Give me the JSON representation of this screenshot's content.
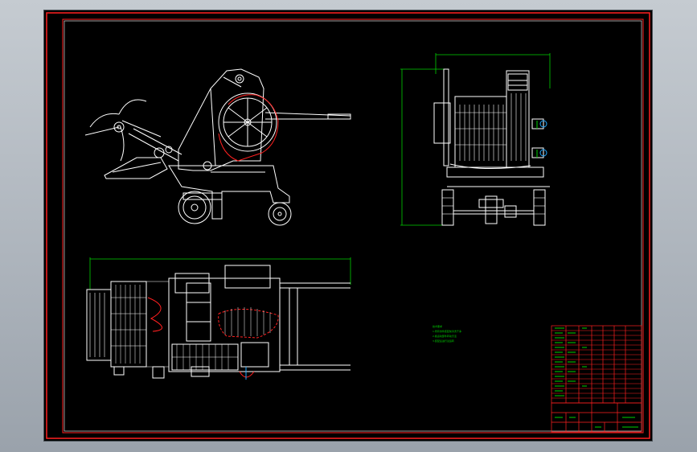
{
  "viewer": {
    "background_color": "#b3bac2",
    "sheet_color": "#000000",
    "frame_color": "#ff2020",
    "line_color": "#ffffff",
    "dimension_color": "#00d000",
    "highlight_color": "#ff2020",
    "accent_color": "#22a9ff"
  },
  "drawing": {
    "views": [
      "side-elevation",
      "end-elevation",
      "plan-view"
    ],
    "notes_block": {
      "heading": "技术要求",
      "lines": [
        "1.所有零件装配前清洗干净",
        "2.各运动部件转动灵活",
        "3.装配后进行试运转"
      ]
    },
    "parts_list_rows": 15,
    "title_block": {
      "title": "",
      "drawing_no": ""
    }
  }
}
